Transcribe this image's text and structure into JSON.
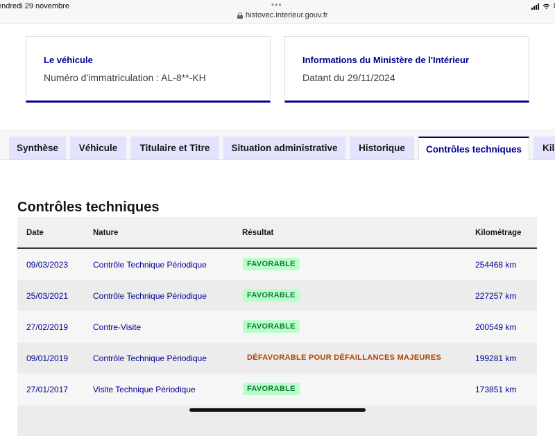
{
  "status_bar": {
    "time": "endredi 29 novembre",
    "dots": "•••",
    "url": "histovec.interieur.gouv.fr",
    "battery_glimpse": "8"
  },
  "cards": [
    {
      "title": "Le véhicule",
      "text": "Numéro d'immatriculation : AL-8**-KH"
    },
    {
      "title": "Informations du Ministère de l'Intérieur",
      "text": "Datant du 29/11/2024"
    }
  ],
  "tabs": [
    {
      "label": "Synthèse"
    },
    {
      "label": "Véhicule"
    },
    {
      "label": "Titulaire et Titre"
    },
    {
      "label": "Situation administrative"
    },
    {
      "label": "Historique"
    },
    {
      "label": "Contrôles techniques",
      "active": true
    },
    {
      "label": "Kilo"
    }
  ],
  "section": {
    "title": "Contrôles techniques"
  },
  "table": {
    "headers": {
      "date": "Date",
      "nature": "Nature",
      "result": "Résultat",
      "mileage": "Kilométrage"
    },
    "rows": [
      {
        "date": "09/03/2023",
        "nature": "Contrôle Technique Périodique",
        "result": "FAVORABLE",
        "mileage": "254468 km"
      },
      {
        "date": "25/03/2021",
        "nature": "Contrôle Technique Périodique",
        "result": "FAVORABLE",
        "mileage": "227257 km"
      },
      {
        "date": "27/02/2019",
        "nature": "Contre-Visite",
        "result": "FAVORABLE",
        "mileage": "200549 km"
      },
      {
        "date": "09/01/2019",
        "nature": "Contrôle Technique Périodique",
        "result": "DÉFAVORABLE POUR DÉFAILLANCES MAJEURES",
        "mileage": "199281 km"
      },
      {
        "date": "27/01/2017",
        "nature": "Visite Technique Périodique",
        "result": "FAVORABLE",
        "mileage": "173851 km"
      }
    ]
  },
  "colors": {
    "accent": "#000091",
    "favorable_bg": "#b8fec9",
    "favorable_text": "#18753c",
    "unfavorable_text": "#b34000",
    "tab_bg": "#e3e3fd"
  }
}
